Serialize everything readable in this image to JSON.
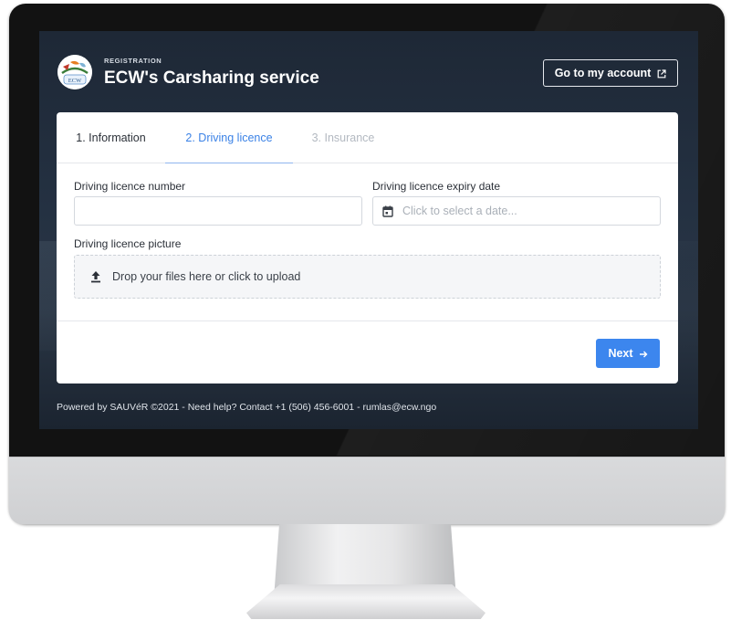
{
  "header": {
    "eyebrow": "REGISTRATION",
    "title": "ECW's Carsharing service",
    "logo_text": "ECW",
    "account_button": "Go to my account"
  },
  "tabs": [
    {
      "label": "1. Information",
      "state": "completed"
    },
    {
      "label": "2. Driving licence",
      "state": "active"
    },
    {
      "label": "3. Insurance",
      "state": "disabled"
    }
  ],
  "form": {
    "licence_number": {
      "label": "Driving licence number",
      "value": "",
      "placeholder": ""
    },
    "expiry_date": {
      "label": "Driving licence expiry date",
      "placeholder": "Click to select a date..."
    },
    "picture": {
      "label": "Driving licence picture",
      "dropzone_text": "Drop your files here or click to upload"
    }
  },
  "actions": {
    "next": "Next"
  },
  "footer": {
    "text": "Powered by SAUVéR ©2021 - Need help? Contact +1 (506) 456-6001 - rumlas@ecw.ngo"
  },
  "colors": {
    "accent": "#3c86ee",
    "screen_bg": "#243142",
    "card_bg": "#ffffff",
    "muted_text": "#b3b9c1"
  },
  "icons": {
    "account_button": "external-link-icon",
    "date_field": "calendar-icon",
    "dropzone": "upload-icon",
    "next_button": "arrow-right-icon"
  }
}
